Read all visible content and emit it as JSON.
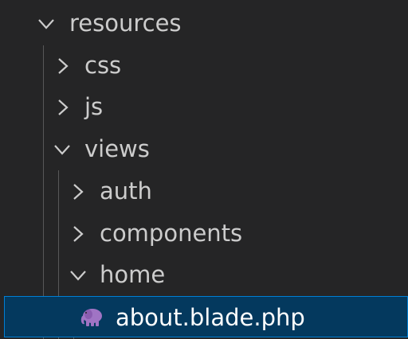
{
  "explorer": {
    "items": [
      {
        "label": "resources",
        "expanded": true,
        "kind": "folder"
      },
      {
        "label": "css",
        "expanded": false,
        "kind": "folder"
      },
      {
        "label": "js",
        "expanded": false,
        "kind": "folder"
      },
      {
        "label": "views",
        "expanded": true,
        "kind": "folder"
      },
      {
        "label": "auth",
        "expanded": false,
        "kind": "folder"
      },
      {
        "label": "components",
        "expanded": false,
        "kind": "folder"
      },
      {
        "label": "home",
        "expanded": true,
        "kind": "folder"
      },
      {
        "label": "about.blade.php",
        "kind": "file",
        "icon": "elephant-icon",
        "selected": true
      }
    ]
  },
  "colors": {
    "background": "#252526",
    "text": "#cccccc",
    "selection_bg": "#04395e",
    "selection_border": "#007fd4",
    "indent_guide": "#585858",
    "file_icon": "#a074c4"
  }
}
